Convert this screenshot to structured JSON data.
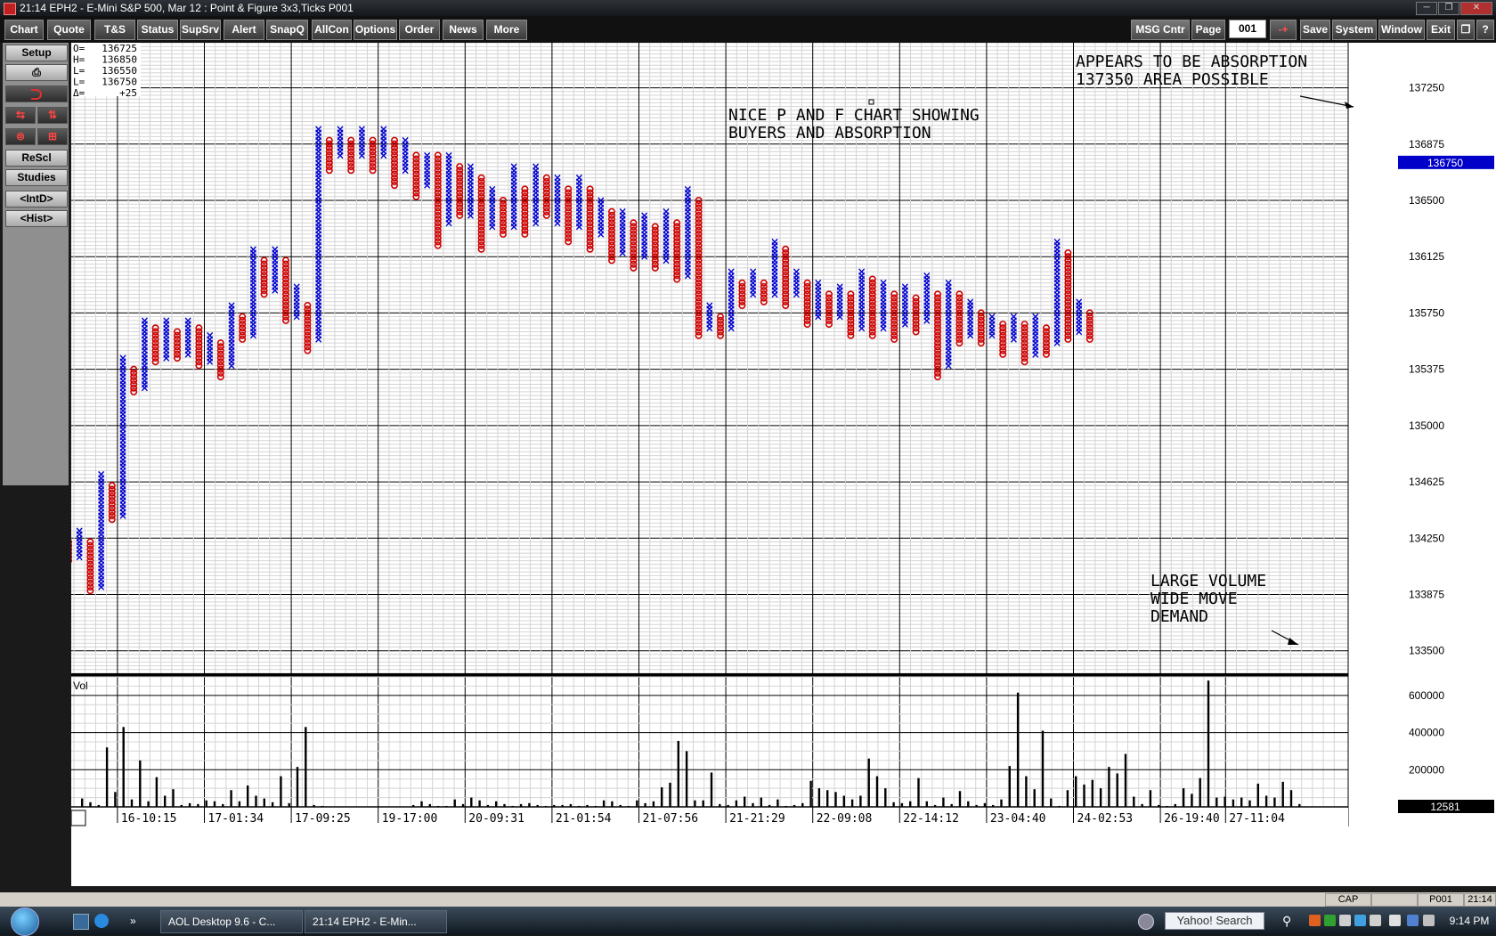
{
  "window": {
    "title": "21:14   EPH2 - E-Mini S&P 500, Mar 12 : Point & Figure 3x3,Ticks   P001",
    "controls": [
      "─",
      "❐",
      "✕"
    ]
  },
  "menubar": {
    "left": [
      "Chart",
      "Quote",
      "T&S",
      "Status",
      "SupSrv",
      "Alert",
      "SnapQ",
      "AllCon",
      "Options",
      "Order",
      "News",
      "More"
    ],
    "msg_center": "MSG Cntr",
    "page_label": "Page",
    "page_value": "001",
    "page_arrows": "-+",
    "right": [
      "Save",
      "System",
      "Window",
      "Exit"
    ],
    "restore": "❐",
    "help": "?"
  },
  "sidebar": {
    "setup": "Setup",
    "print_icon": "⎙",
    "rescale": "ReScl",
    "studies": "Studies",
    "intraday": "<IntD>",
    "history": "<Hist>"
  },
  "colors": {
    "x_mark": "#0000d0",
    "o_mark": "#d00000",
    "grid_minor": "#d4d4d4",
    "grid_major": "#000000",
    "price_highlight": "#0000c8"
  },
  "annotations": {
    "main": [
      "NICE P AND F CHART SHOWING",
      "BUYERS AND ABSORPTION"
    ],
    "top_right": [
      "APPEARS TO BE ABSORPTION",
      "137350 AREA POSSIBLE"
    ],
    "bottom_right": [
      "LARGE VOLUME",
      "WIDE MOVE",
      "DEMAND"
    ]
  },
  "statusbar": {
    "cap": "CAP",
    "page": "P001",
    "time": "21:14"
  },
  "taskbar": {
    "items": [
      "AOL Desktop 9.6 - C...",
      "21:14  EPH2 - E-Min..."
    ],
    "search_placeholder": "Yahoo! Search",
    "clock": "9:14 PM"
  },
  "chart_data": {
    "type": "point_and_figure",
    "box_size": 25,
    "reversal": 3,
    "ohlc_box": {
      "labels": [
        "O=",
        "H=",
        "L=",
        "L=",
        "Δ="
      ],
      "values": [
        "136725",
        "136850",
        "136550",
        "136750",
        "+25"
      ]
    },
    "price_axis": {
      "ticks": [
        137250,
        136875,
        136500,
        136125,
        135750,
        135375,
        135000,
        134625,
        134250,
        133875,
        133500
      ],
      "current": "136750",
      "ylim": [
        133350,
        137550
      ]
    },
    "time_axis": {
      "ticks": [
        "16-10:15",
        "17-01:34",
        "17-09:25",
        "19-17:00",
        "20-09:31",
        "21-01:54",
        "21-07:56",
        "21-21:29",
        "22-09:08",
        "22-14:12",
        "23-04:40",
        "24-02:53",
        "26-19:40",
        "27-11:04"
      ],
      "tick_columns": [
        5,
        13,
        21,
        29,
        37,
        45,
        53,
        61,
        69,
        77,
        85,
        93,
        101,
        107
      ]
    },
    "volume_axis": {
      "label": "Vol",
      "ticks": [
        600000,
        400000,
        200000
      ],
      "current": "12581",
      "ylim": [
        0,
        700000
      ]
    },
    "columns": [
      {
        "t": "O",
        "hi": 134225,
        "lo": 134100
      },
      {
        "t": "X",
        "hi": 134300,
        "lo": 134125
      },
      {
        "t": "O",
        "hi": 134225,
        "lo": 133900
      },
      {
        "t": "X",
        "hi": 134675,
        "lo": 133925
      },
      {
        "t": "O",
        "hi": 134600,
        "lo": 134375
      },
      {
        "t": "X",
        "hi": 135450,
        "lo": 134400
      },
      {
        "t": "O",
        "hi": 135375,
        "lo": 135225
      },
      {
        "t": "X",
        "hi": 135700,
        "lo": 135250
      },
      {
        "t": "O",
        "hi": 135650,
        "lo": 135425
      },
      {
        "t": "X",
        "hi": 135700,
        "lo": 135450
      },
      {
        "t": "O",
        "hi": 135625,
        "lo": 135450
      },
      {
        "t": "X",
        "hi": 135700,
        "lo": 135475
      },
      {
        "t": "O",
        "hi": 135650,
        "lo": 135400
      },
      {
        "t": "X",
        "hi": 135600,
        "lo": 135425
      },
      {
        "t": "O",
        "hi": 135550,
        "lo": 135325
      },
      {
        "t": "X",
        "hi": 135800,
        "lo": 135400
      },
      {
        "t": "O",
        "hi": 135725,
        "lo": 135575
      },
      {
        "t": "X",
        "hi": 136175,
        "lo": 135600
      },
      {
        "t": "O",
        "hi": 136100,
        "lo": 135875
      },
      {
        "t": "X",
        "hi": 136175,
        "lo": 135900
      },
      {
        "t": "O",
        "hi": 136100,
        "lo": 135700
      },
      {
        "t": "X",
        "hi": 135925,
        "lo": 135725
      },
      {
        "t": "O",
        "hi": 135800,
        "lo": 135500
      },
      {
        "t": "X",
        "hi": 136975,
        "lo": 135575
      },
      {
        "t": "O",
        "hi": 136900,
        "lo": 136700
      },
      {
        "t": "X",
        "hi": 136975,
        "lo": 136800
      },
      {
        "t": "O",
        "hi": 136900,
        "lo": 136700
      },
      {
        "t": "X",
        "hi": 136975,
        "lo": 136800
      },
      {
        "t": "O",
        "hi": 136900,
        "lo": 136700
      },
      {
        "t": "X",
        "hi": 136975,
        "lo": 136800
      },
      {
        "t": "O",
        "hi": 136900,
        "lo": 136600
      },
      {
        "t": "X",
        "hi": 136900,
        "lo": 136700
      },
      {
        "t": "O",
        "hi": 136800,
        "lo": 136525
      },
      {
        "t": "X",
        "hi": 136800,
        "lo": 136600
      },
      {
        "t": "O",
        "hi": 136800,
        "lo": 136200
      },
      {
        "t": "X",
        "hi": 136800,
        "lo": 136350
      },
      {
        "t": "O",
        "hi": 136725,
        "lo": 136400
      },
      {
        "t": "X",
        "hi": 136725,
        "lo": 136400
      },
      {
        "t": "O",
        "hi": 136650,
        "lo": 136175
      },
      {
        "t": "X",
        "hi": 136575,
        "lo": 136325
      },
      {
        "t": "O",
        "hi": 136500,
        "lo": 136275
      },
      {
        "t": "X",
        "hi": 136725,
        "lo": 136325
      },
      {
        "t": "O",
        "hi": 136575,
        "lo": 136275
      },
      {
        "t": "X",
        "hi": 136725,
        "lo": 136350
      },
      {
        "t": "O",
        "hi": 136650,
        "lo": 136400
      },
      {
        "t": "X",
        "hi": 136650,
        "lo": 136350
      },
      {
        "t": "O",
        "hi": 136575,
        "lo": 136225
      },
      {
        "t": "X",
        "hi": 136650,
        "lo": 136325
      },
      {
        "t": "O",
        "hi": 136575,
        "lo": 136175
      },
      {
        "t": "X",
        "hi": 136500,
        "lo": 136275
      },
      {
        "t": "O",
        "hi": 136425,
        "lo": 136100
      },
      {
        "t": "X",
        "hi": 136425,
        "lo": 136150
      },
      {
        "t": "O",
        "hi": 136350,
        "lo": 136050
      },
      {
        "t": "X",
        "hi": 136400,
        "lo": 136125
      },
      {
        "t": "O",
        "hi": 136325,
        "lo": 136050
      },
      {
        "t": "X",
        "hi": 136425,
        "lo": 136100
      },
      {
        "t": "O",
        "hi": 136350,
        "lo": 135975
      },
      {
        "t": "X",
        "hi": 136575,
        "lo": 136000
      },
      {
        "t": "O",
        "hi": 136500,
        "lo": 135600
      },
      {
        "t": "X",
        "hi": 135800,
        "lo": 135650
      },
      {
        "t": "O",
        "hi": 135725,
        "lo": 135600
      },
      {
        "t": "X",
        "hi": 136025,
        "lo": 135650
      },
      {
        "t": "O",
        "hi": 135950,
        "lo": 135800
      },
      {
        "t": "X",
        "hi": 136025,
        "lo": 135875
      },
      {
        "t": "O",
        "hi": 135950,
        "lo": 135825
      },
      {
        "t": "X",
        "hi": 136225,
        "lo": 135875
      },
      {
        "t": "O",
        "hi": 136175,
        "lo": 135800
      },
      {
        "t": "X",
        "hi": 136025,
        "lo": 135875
      },
      {
        "t": "O",
        "hi": 135950,
        "lo": 135675
      },
      {
        "t": "X",
        "hi": 135950,
        "lo": 135725
      },
      {
        "t": "O",
        "hi": 135875,
        "lo": 135675
      },
      {
        "t": "X",
        "hi": 135925,
        "lo": 135725
      },
      {
        "t": "O",
        "hi": 135875,
        "lo": 135600
      },
      {
        "t": "X",
        "hi": 136025,
        "lo": 135650
      },
      {
        "t": "O",
        "hi": 135975,
        "lo": 135600
      },
      {
        "t": "X",
        "hi": 135950,
        "lo": 135650
      },
      {
        "t": "O",
        "hi": 135875,
        "lo": 135575
      },
      {
        "t": "X",
        "hi": 135925,
        "lo": 135675
      },
      {
        "t": "O",
        "hi": 135850,
        "lo": 135625
      },
      {
        "t": "X",
        "hi": 136000,
        "lo": 135700
      },
      {
        "t": "O",
        "hi": 135875,
        "lo": 135325
      },
      {
        "t": "X",
        "hi": 135950,
        "lo": 135400
      },
      {
        "t": "O",
        "hi": 135875,
        "lo": 135550
      },
      {
        "t": "X",
        "hi": 135825,
        "lo": 135600
      },
      {
        "t": "O",
        "hi": 135750,
        "lo": 135550
      },
      {
        "t": "X",
        "hi": 135725,
        "lo": 135600
      },
      {
        "t": "O",
        "hi": 135675,
        "lo": 135475
      },
      {
        "t": "X",
        "hi": 135725,
        "lo": 135575
      },
      {
        "t": "O",
        "hi": 135675,
        "lo": 135425
      },
      {
        "t": "X",
        "hi": 135725,
        "lo": 135475
      },
      {
        "t": "O",
        "hi": 135650,
        "lo": 135475
      },
      {
        "t": "X",
        "hi": 136225,
        "lo": 135550
      },
      {
        "t": "O",
        "hi": 136150,
        "lo": 135575
      },
      {
        "t": "X",
        "hi": 135825,
        "lo": 135625
      },
      {
        "t": "O",
        "hi": 135750,
        "lo": 135575
      }
    ],
    "volume": [
      45000,
      25000,
      10000,
      320000,
      80000,
      430000,
      40000,
      250000,
      30000,
      160000,
      60000,
      95000,
      10000,
      20000,
      15000,
      35000,
      30000,
      15000,
      90000,
      30000,
      115000,
      60000,
      45000,
      25000,
      165000,
      20000,
      215000,
      430000,
      10000,
      5000,
      0,
      0,
      0,
      0,
      0,
      0,
      0,
      0,
      0,
      0,
      10000,
      30000,
      15000,
      5000,
      5000,
      40000,
      15000,
      50000,
      35000,
      10000,
      30000,
      15000,
      5000,
      15000,
      20000,
      10000,
      5000,
      10000,
      10000,
      15000,
      5000,
      10000,
      5000,
      35000,
      30000,
      10000,
      5000,
      35000,
      20000,
      30000,
      105000,
      130000,
      355000,
      300000,
      35000,
      35000,
      185000,
      15000,
      10000,
      35000,
      55000,
      20000,
      50000,
      10000,
      40000,
      5000,
      10000,
      20000,
      140000,
      100000,
      90000,
      80000,
      60000,
      40000,
      60000,
      260000,
      165000,
      100000,
      25000,
      20000,
      30000,
      155000,
      30000,
      10000,
      50000,
      15000,
      85000,
      30000,
      10000,
      20000,
      10000,
      40000,
      220000,
      615000,
      165000,
      95000,
      410000,
      45000,
      5000,
      90000,
      165000,
      120000,
      145000,
      100000,
      215000,
      180000,
      285000,
      55000,
      15000,
      90000,
      10000,
      5000,
      15000,
      100000,
      70000,
      155000,
      680000,
      50000,
      55000,
      40000,
      50000,
      35000,
      125000,
      60000,
      50000,
      135000,
      90000,
      15000
    ]
  }
}
